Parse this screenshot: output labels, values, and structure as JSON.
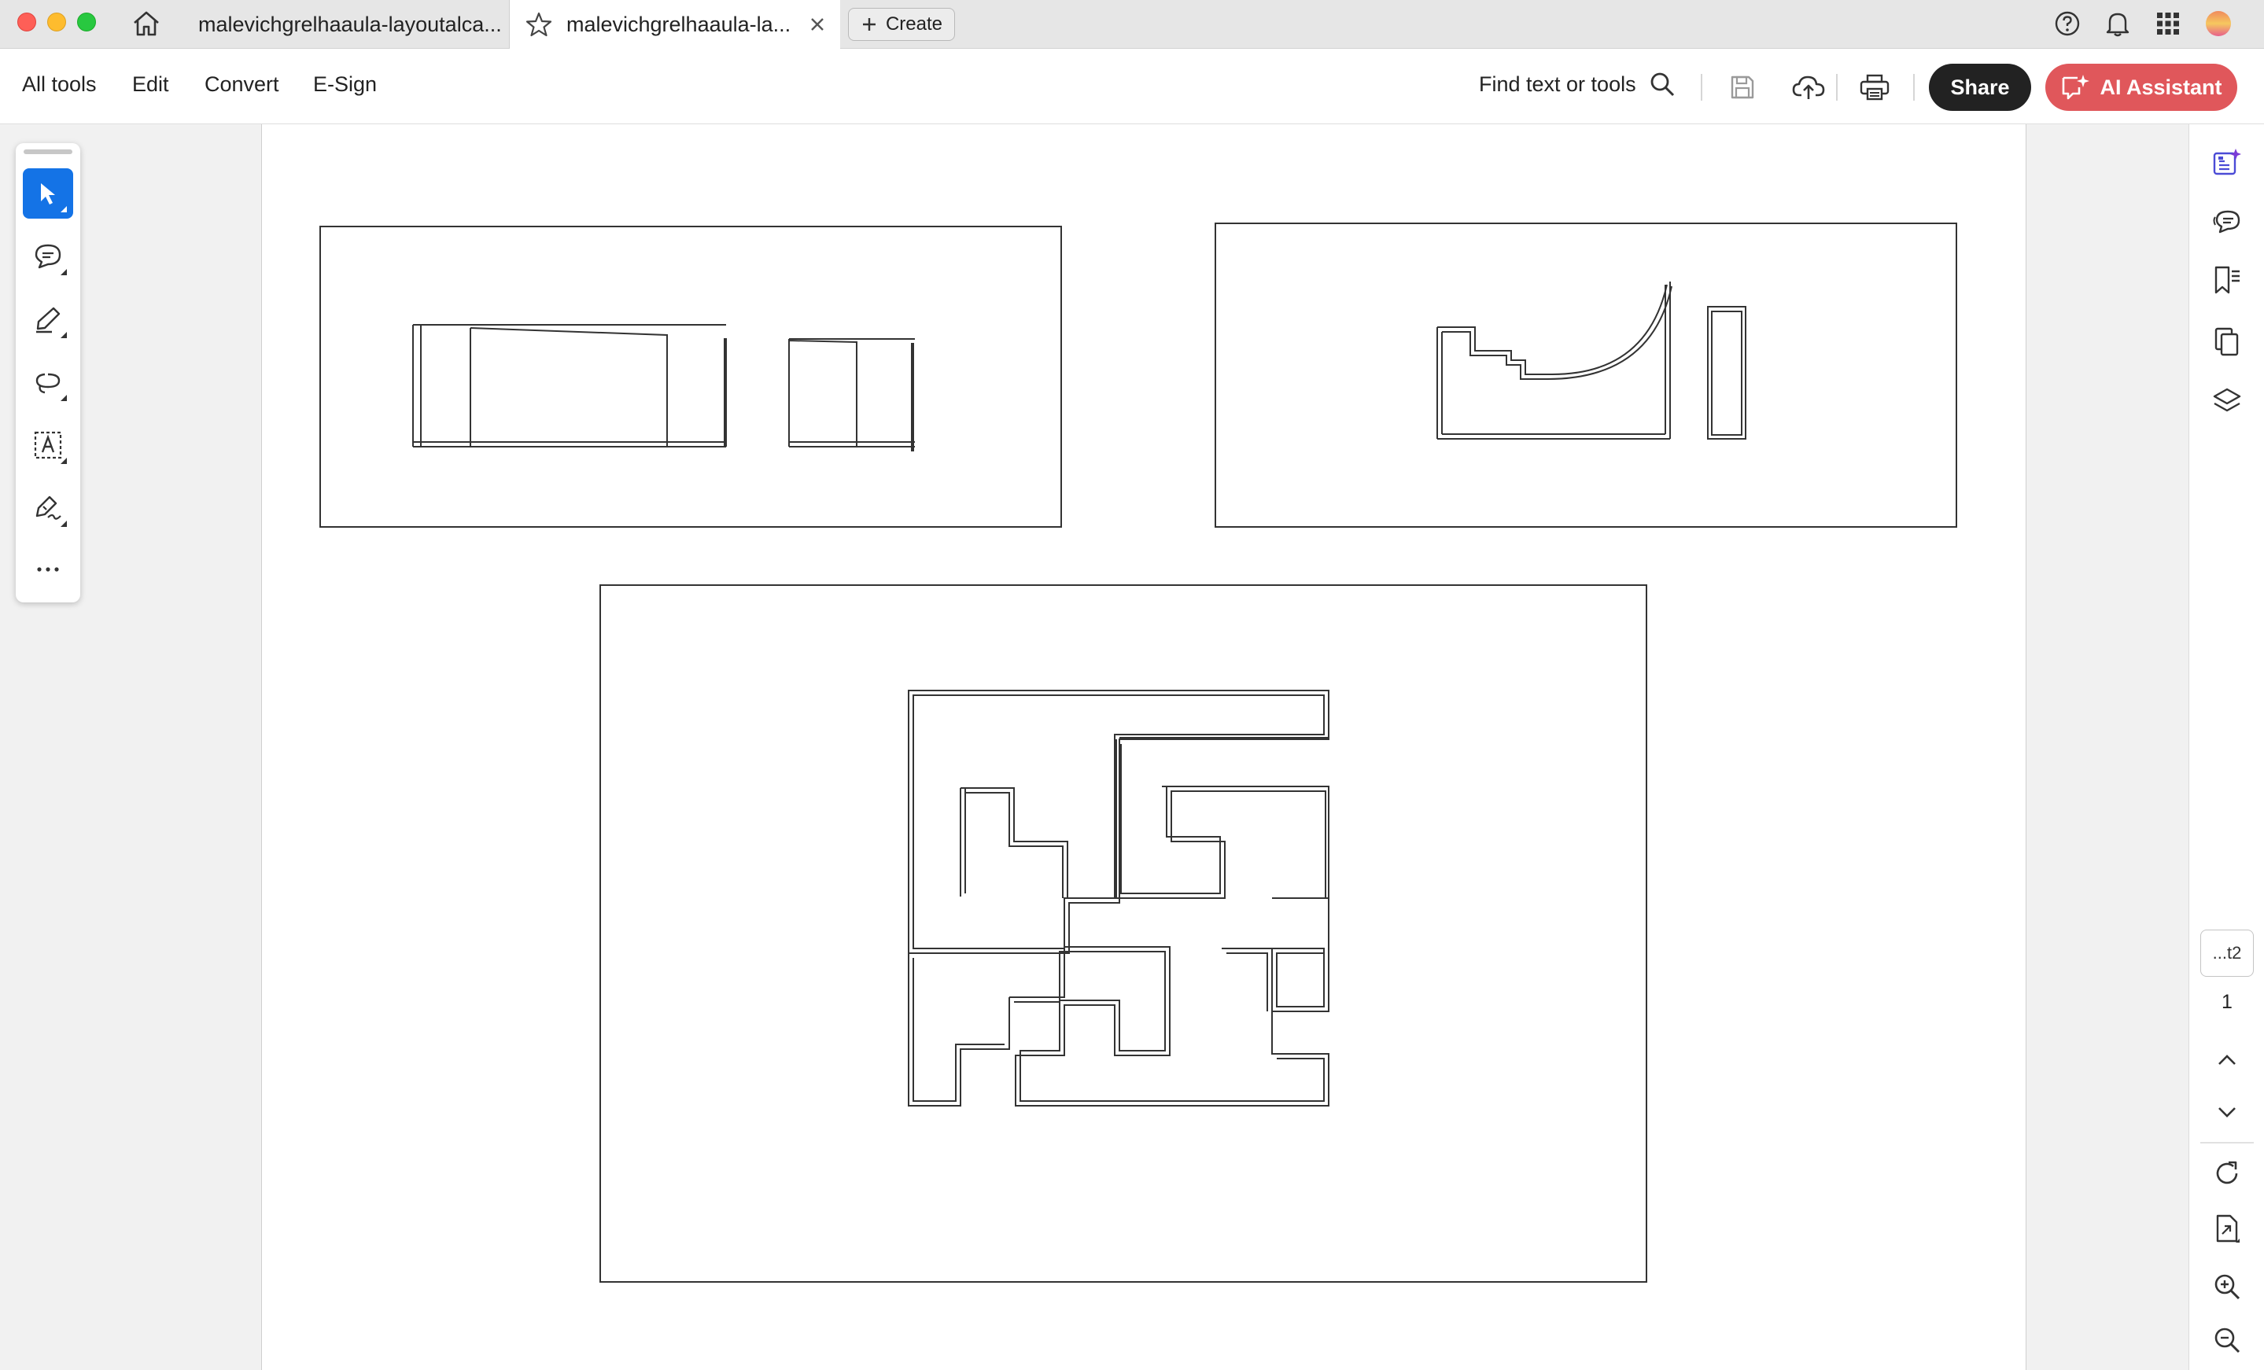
{
  "browser": {
    "tabs": [
      {
        "title": "malevichgrelhaaula-layoutalca..."
      },
      {
        "title": "malevichgrelhaaula-la..."
      }
    ],
    "create_label": "Create"
  },
  "toolbar": {
    "menu": [
      "All tools",
      "Edit",
      "Convert",
      "E-Sign"
    ],
    "find_label": "Find text or tools",
    "share_label": "Share",
    "ai_label": "AI Assistant"
  },
  "right_rail": {
    "page_box_label": "...t2",
    "page_number": "1"
  },
  "colors": {
    "accent_blue": "#1473e6",
    "ai_button": "#e0575b",
    "share_button": "#222222"
  },
  "icons": {
    "left_panel": [
      "select-arrow-icon",
      "comment-icon",
      "highlight-pen-icon",
      "lasso-draw-icon",
      "text-box-icon",
      "signature-pen-icon",
      "more-icon"
    ],
    "right_rail": [
      "ai-summary-icon",
      "comments-list-icon",
      "bookmarks-icon",
      "pages-icon",
      "layers-icon",
      "rotate-icon",
      "page-extract-icon",
      "zoom-in-icon",
      "zoom-out-icon"
    ]
  }
}
